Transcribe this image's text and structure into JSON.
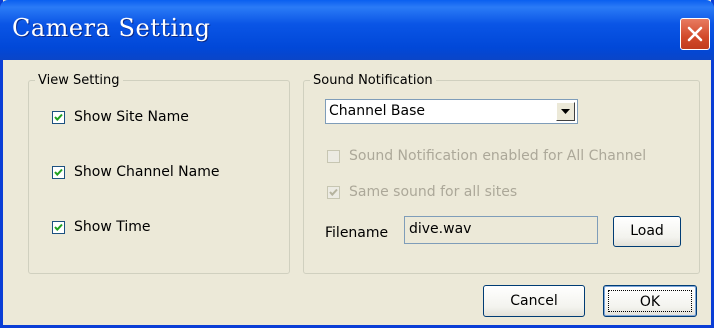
{
  "window": {
    "title": "Camera Setting"
  },
  "view_setting": {
    "legend": "View Setting",
    "options": [
      {
        "label": "Show Site Name",
        "checked": true
      },
      {
        "label": "Show Channel Name",
        "checked": true
      },
      {
        "label": "Show Time",
        "checked": true
      }
    ]
  },
  "sound_notification": {
    "legend": "Sound Notification",
    "mode_select": {
      "value": "Channel Base"
    },
    "all_channel": {
      "label": "Sound Notification enabled for All Channel",
      "checked": false,
      "enabled": false
    },
    "same_sound": {
      "label": "Same sound for all sites",
      "checked": true,
      "enabled": false
    },
    "filename_label": "Filename",
    "filename_value": "dive.wav",
    "load_label": "Load"
  },
  "footer": {
    "cancel_label": "Cancel",
    "ok_label": "OK"
  },
  "colors": {
    "title_bar": "#0a55e6",
    "dialog_bg": "#ece9d8",
    "close_button": "#d24a2a"
  },
  "icons": {
    "close": "close-icon",
    "check": "checkmark-icon",
    "dropdown": "chevron-down-icon"
  }
}
